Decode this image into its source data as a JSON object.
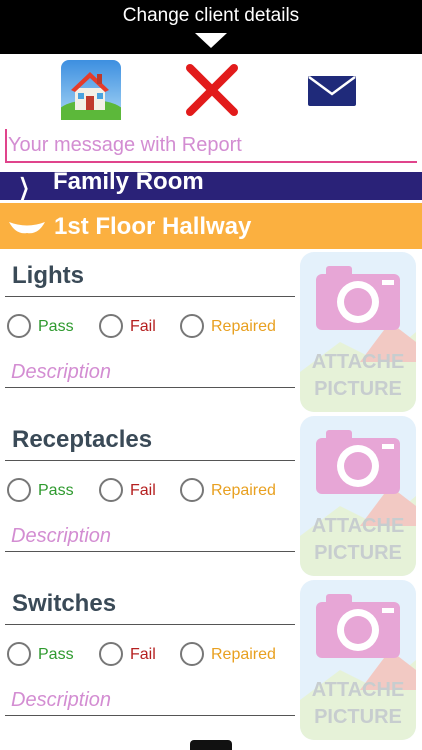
{
  "header": {
    "title": "Change client details"
  },
  "toolbar": {
    "home_icon": "house-icon",
    "close_icon": "red-x-icon",
    "mail_icon": "envelope-icon"
  },
  "message": {
    "placeholder": "Your message with Report",
    "value": ""
  },
  "sections": [
    {
      "label": "Family Room",
      "state": "collapsed",
      "color": "#2a2278"
    },
    {
      "label": "1st Floor Hallway",
      "state": "expanded",
      "color": "#fbb040"
    }
  ],
  "items": [
    {
      "title": "Lights",
      "options": [
        "Pass",
        "Fail",
        "Repaired"
      ],
      "description_placeholder": "Description",
      "photo_text": [
        "ATTACHE",
        "PICTURE"
      ]
    },
    {
      "title": "Receptacles",
      "options": [
        "Pass",
        "Fail",
        "Repaired"
      ],
      "description_placeholder": "Description",
      "photo_text": [
        "ATTACHE",
        "PICTURE"
      ]
    },
    {
      "title": "Switches",
      "options": [
        "Pass",
        "Fail",
        "Repaired"
      ],
      "description_placeholder": "Description",
      "photo_text": [
        "ATTACHE",
        "PICTURE"
      ]
    }
  ],
  "colors": {
    "pass": "#2f9a2f",
    "fail": "#b52020",
    "repaired": "#e8a020",
    "accent": "#e0448c",
    "placeholder": "#d38dd2"
  }
}
